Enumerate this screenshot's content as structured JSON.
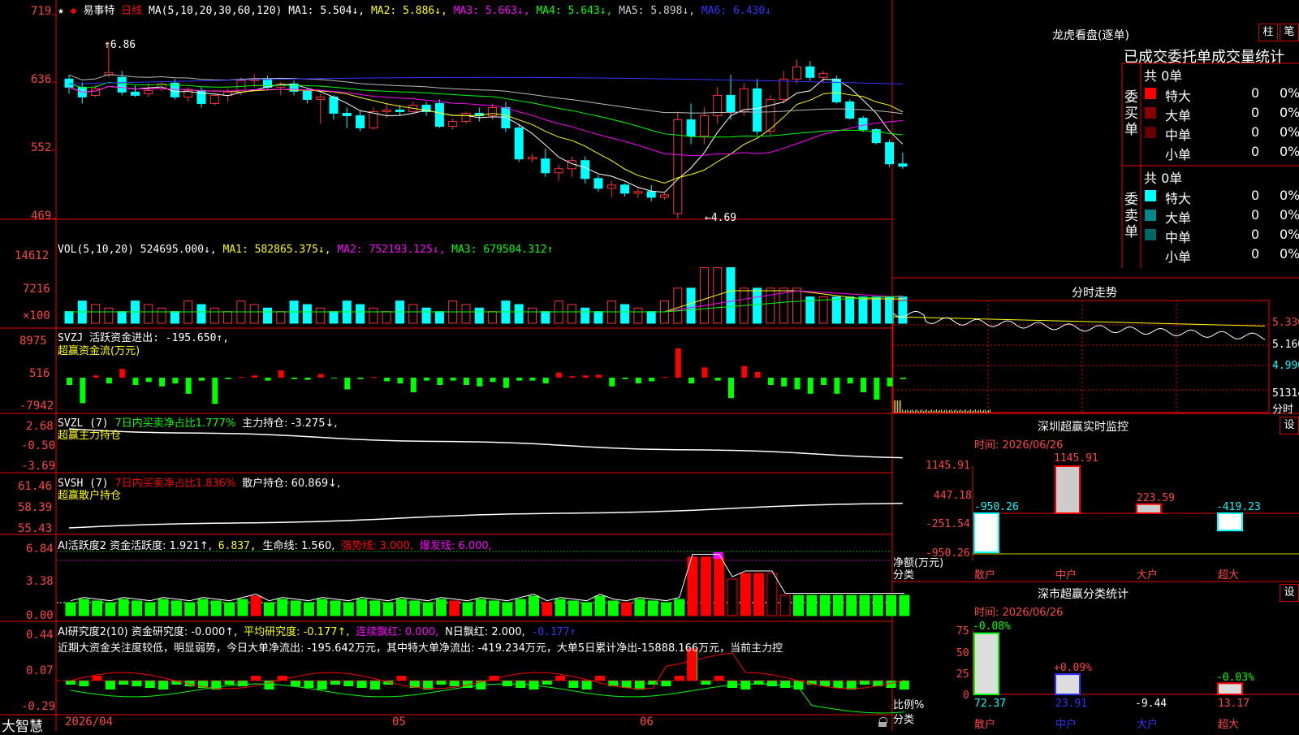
{
  "main_header": {
    "star": "★",
    "arrow": "◆",
    "stock": "易事特",
    "period": "日线",
    "ma_prefix": "MA(5,10,20,30,60,120)",
    "ma1": "MA1: 5.504↓,",
    "ma2": "MA2: 5.886↓,",
    "ma3": "MA3: 5.663↓,",
    "ma4": "MA4: 5.643↓,",
    "ma5": "MA5: 5.898↓,",
    "ma6": "MA6: 6.430↓"
  },
  "main_axis": [
    "719",
    "636",
    "552",
    "469"
  ],
  "main_annotations": {
    "high": "↑6.86",
    "low": "←4.69"
  },
  "vol": {
    "prefix": "VOL(5,10,20)",
    "value": "524695.000↓,",
    "ma1": "MA1: 582865.375↓,",
    "ma2": "MA2: 752193.125↓,",
    "ma3": "MA3: 679504.312↑",
    "axis": [
      "14612",
      "7216",
      "×100"
    ]
  },
  "svzj": {
    "title": "SVZJ  活跃资金进出: -195.650↑,",
    "sub": "超赢资金流(万元)",
    "axis": [
      "8975",
      "516",
      "-7942"
    ]
  },
  "svzl": {
    "prefix": "SVZL (7)",
    "mid": "7日内买卖净占比1.777%",
    "tail": "主力持仓: -3.275↓,",
    "sub": "超赢主力持仓",
    "axis": [
      "2.68",
      "-0.50",
      "-3.69"
    ]
  },
  "svsh": {
    "prefix": "SVSH (7)",
    "mid": "7日内买卖净占比1.836%",
    "tail": "散户持仓: 60.869↓,",
    "sub": "超赢散户持仓",
    "axis": [
      "61.46",
      "58.39",
      "55.43"
    ]
  },
  "ai1": {
    "prefix": "AI活跃度2 资金活跃度: 1.921↑,",
    "v2": "6.837,",
    "v3": "生命线: 1.560,",
    "v4": "强势线: 3.000,",
    "v5": "爆发线: 6.000,",
    "axis": [
      "6.84",
      "3.38",
      "0.00"
    ]
  },
  "ai2": {
    "prefix": "AI研究度2(10) 资金研究度: -0.000↑,",
    "v2": "平均研究度: -0.177↑,",
    "v3": "连续飘红: 0.000,",
    "v4": "N日飘红: 2.000,",
    "v5": "-0.177↑",
    "desc": "近期大资金关注度较低，明显弱势，今日大单净流出: -195.642万元，其中特大单净流出: -419.234万元，大单5日累计净出-15888.166万元，当前主力控",
    "axis": [
      "0.44",
      "0.07",
      "-0.29"
    ]
  },
  "bottom_bar": {
    "brand": "大智慧",
    "dates": [
      "2026/04",
      "05",
      "06"
    ]
  },
  "dragon": {
    "title": "龙虎看盘(逐单)",
    "btn1": "柱",
    "btn2": "笔",
    "header": "已成交委托单成交量统计",
    "buy_label": "委买单",
    "sell_label": "委卖单",
    "buy_total": "共 0单",
    "sell_total": "共 0单",
    "rows": [
      {
        "name": "特大",
        "count": "0",
        "pct": "0%"
      },
      {
        "name": "大单",
        "count": "0",
        "pct": "0%"
      },
      {
        "name": "中单",
        "count": "0",
        "pct": "0%"
      },
      {
        "name": "小单",
        "count": "0",
        "pct": "0%"
      }
    ],
    "buy_colors": [
      "#ff0000",
      "#880000",
      "#660000",
      ""
    ],
    "sell_colors": [
      "#00ffff",
      "#008888",
      "#006666",
      ""
    ]
  },
  "intraday": {
    "title": "分时走势",
    "axis": [
      "5.330",
      "5.160",
      "4.990",
      "51314",
      "分时"
    ]
  },
  "sz_monitor": {
    "title": "深圳超赢实时监控",
    "setting": "设",
    "time": "时间: 2026/06/26",
    "axis": [
      "1145.91",
      "447.18",
      "-251.54",
      "-950.26"
    ],
    "unit": "净额(万元)",
    "cat_label": "分类",
    "categories": [
      "散户",
      "中户",
      "大户",
      "超大"
    ],
    "values": [
      -950.26,
      1145.91,
      223.59,
      -419.23
    ],
    "value_labels": [
      "-950.26",
      "1145.91",
      "223.59",
      "-419.23"
    ]
  },
  "sz_class": {
    "title": "深市超赢分类统计",
    "setting": "设",
    "time": "时间: 2026/06/26",
    "axis": [
      "75",
      "50",
      "25",
      "0"
    ],
    "unit": "比例%",
    "cat_label": "分类",
    "categories": [
      "散户",
      "中户",
      "大户",
      "超大"
    ],
    "bottom_values": [
      "72.37",
      "23.91",
      "-9.44",
      "13.17"
    ],
    "top_labels": [
      "-0.08%",
      "+0.09%",
      "",
      "-0.03%"
    ],
    "bar_values": [
      72.37,
      23.91,
      0,
      13.17
    ]
  },
  "chart_data": {
    "type": "candlestick",
    "candles_ohlc": [
      [
        6.4,
        6.45,
        6.22,
        6.3
      ],
      [
        6.3,
        6.36,
        6.1,
        6.18
      ],
      [
        6.2,
        6.32,
        6.18,
        6.28
      ],
      [
        6.45,
        6.86,
        6.42,
        6.48
      ],
      [
        6.42,
        6.5,
        6.2,
        6.24
      ],
      [
        6.24,
        6.32,
        6.18,
        6.2
      ],
      [
        6.22,
        6.35,
        6.18,
        6.26
      ],
      [
        6.28,
        6.36,
        6.25,
        6.34
      ],
      [
        6.35,
        6.4,
        6.15,
        6.18
      ],
      [
        6.18,
        6.3,
        6.12,
        6.26
      ],
      [
        6.26,
        6.3,
        6.05,
        6.1
      ],
      [
        6.1,
        6.22,
        6.08,
        6.2
      ],
      [
        6.2,
        6.28,
        6.12,
        6.24
      ],
      [
        6.24,
        6.42,
        6.2,
        6.38
      ],
      [
        6.38,
        6.46,
        6.3,
        6.4
      ],
      [
        6.4,
        6.44,
        6.28,
        6.3
      ],
      [
        6.3,
        6.36,
        6.2,
        6.34
      ],
      [
        6.34,
        6.38,
        6.2,
        6.25
      ],
      [
        6.25,
        6.28,
        6.1,
        6.15
      ],
      [
        6.15,
        6.22,
        5.85,
        6.18
      ],
      [
        6.18,
        6.2,
        5.9,
        5.98
      ],
      [
        5.98,
        6.05,
        5.8,
        5.95
      ],
      [
        5.95,
        6.02,
        5.76,
        5.8
      ],
      [
        5.8,
        6.05,
        5.78,
        6.0
      ],
      [
        6.0,
        6.1,
        5.92,
        6.02
      ],
      [
        6.02,
        6.08,
        5.95,
        6.0
      ],
      [
        6.0,
        6.12,
        5.98,
        6.08
      ],
      [
        6.08,
        6.12,
        5.95,
        6.0
      ],
      [
        6.1,
        6.15,
        5.8,
        5.82
      ],
      [
        5.82,
        5.92,
        5.78,
        5.88
      ],
      [
        5.88,
        6.0,
        5.85,
        5.98
      ],
      [
        5.98,
        6.05,
        5.88,
        5.95
      ],
      [
        5.95,
        6.1,
        5.9,
        6.05
      ],
      [
        6.05,
        6.12,
        5.75,
        5.8
      ],
      [
        5.8,
        5.85,
        5.38,
        5.42
      ],
      [
        5.42,
        5.48,
        5.38,
        5.44
      ],
      [
        5.42,
        5.55,
        5.2,
        5.25
      ],
      [
        5.25,
        5.35,
        5.15,
        5.3
      ],
      [
        5.3,
        5.45,
        5.2,
        5.4
      ],
      [
        5.4,
        5.45,
        5.12,
        5.18
      ],
      [
        5.18,
        5.22,
        5.02,
        5.06
      ],
      [
        5.06,
        5.15,
        4.95,
        5.1
      ],
      [
        5.1,
        5.12,
        4.96,
        5.0
      ],
      [
        5.0,
        5.08,
        4.94,
        5.02
      ],
      [
        5.02,
        5.1,
        4.9,
        4.95
      ],
      [
        4.95,
        5.0,
        4.92,
        4.98
      ],
      [
        4.75,
        6.0,
        4.69,
        5.9
      ],
      [
        5.9,
        6.1,
        5.6,
        5.7
      ],
      [
        5.7,
        6.05,
        5.6,
        5.95
      ],
      [
        5.95,
        6.3,
        5.85,
        6.2
      ],
      [
        6.2,
        6.45,
        5.9,
        6.0
      ],
      [
        6.0,
        6.35,
        5.95,
        6.28
      ],
      [
        6.28,
        6.4,
        5.72,
        5.76
      ],
      [
        5.76,
        6.2,
        5.7,
        6.15
      ],
      [
        6.15,
        6.5,
        6.1,
        6.4
      ],
      [
        6.4,
        6.64,
        6.35,
        6.55
      ],
      [
        6.55,
        6.62,
        6.38,
        6.42
      ],
      [
        6.42,
        6.5,
        6.35,
        6.47
      ],
      [
        6.4,
        6.44,
        6.1,
        6.12
      ],
      [
        6.12,
        6.15,
        5.9,
        5.92
      ],
      [
        5.92,
        5.95,
        5.75,
        5.78
      ],
      [
        5.78,
        5.8,
        5.6,
        5.62
      ],
      [
        5.62,
        5.66,
        5.32,
        5.36
      ],
      [
        5.36,
        5.5,
        5.3,
        5.33
      ]
    ]
  }
}
